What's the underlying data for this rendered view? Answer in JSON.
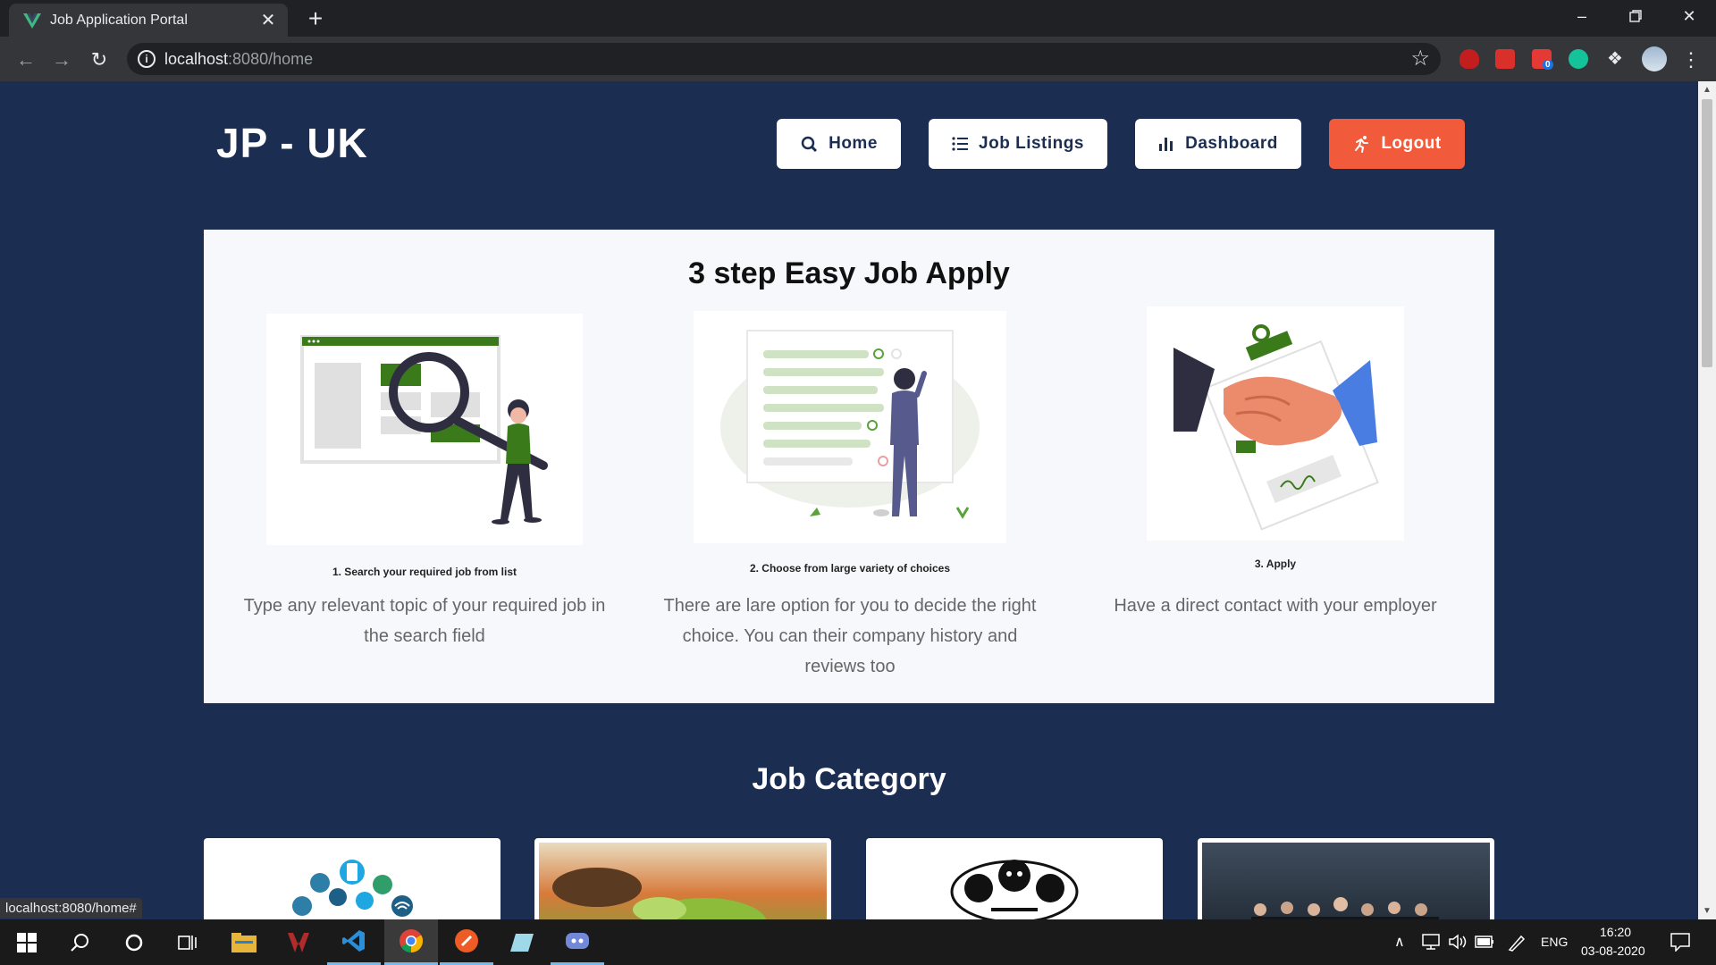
{
  "browser": {
    "tab_title": "Job Application Portal",
    "tab_close": "✕",
    "new_tab": "+",
    "url_host": "localhost",
    "url_path": ":8080/home",
    "status_url": "localhost:8080/home#",
    "extension_badge": "0"
  },
  "header": {
    "logo": "JP - UK",
    "nav": {
      "home": "Home",
      "job_listings": "Job Listings",
      "dashboard": "Dashboard",
      "logout": "Logout"
    }
  },
  "steps": {
    "title": "3 step Easy Job Apply",
    "items": [
      {
        "caption": "1. Search your required job from list",
        "description": "Type any relevant topic of your required job in the search field"
      },
      {
        "caption": "2. Choose from large variety of choices",
        "description": "There are lare option for you to decide the right choice. You can their company history and reviews too"
      },
      {
        "caption": "3. Apply",
        "description": "Have a direct contact with your employer"
      }
    ]
  },
  "categories": {
    "title": "Job Category"
  },
  "taskbar": {
    "language": "ENG",
    "time": "16:20",
    "date": "03-08-2020"
  },
  "colors": {
    "page_bg": "#1b2e52",
    "logout_bg": "#f15a3a",
    "card_bg": "#f7f8fb"
  }
}
